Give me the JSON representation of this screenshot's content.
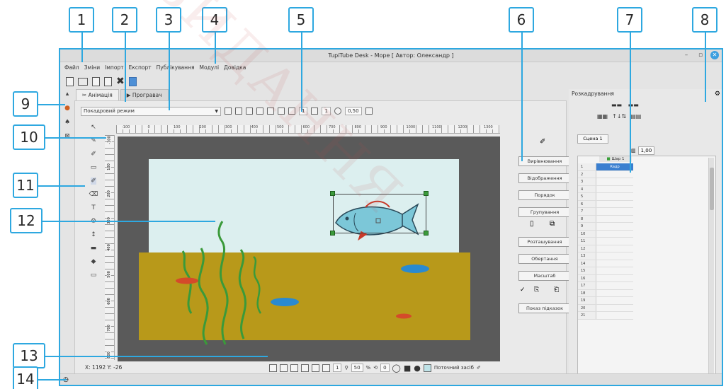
{
  "window": {
    "title": "TupiTube Desk - Море [ Автор: Олександр ]",
    "controls": {
      "minimize": "–",
      "maximize": "▫",
      "close": "✕"
    }
  },
  "menu": [
    "Файл",
    "Зміни",
    "Імпорт",
    "Експорт",
    "Публікування",
    "Модулі",
    "Довідка"
  ],
  "main_toolbar": [
    "new-file-icon",
    "open-folder-icon",
    "save-icon",
    "save-as-icon",
    "close-project-icon",
    "image-icon"
  ],
  "tabs": [
    {
      "label": "Анімація",
      "active": true
    },
    {
      "label": "Програвач",
      "active": false
    }
  ],
  "animation_toolbar": {
    "mode": "Покадровий режим",
    "frame_value": "1",
    "layer_value": "1",
    "opacity_value": "0,50"
  },
  "hruler_ticks": [
    "-100",
    "0",
    "100",
    "200",
    "300",
    "400",
    "500",
    "600",
    "700",
    "800",
    "900",
    "1000",
    "1100",
    "1200",
    "1300"
  ],
  "vruler_ticks": [
    "-100",
    "100",
    "200",
    "300",
    "400",
    "500",
    "600",
    "700",
    "800"
  ],
  "status": {
    "coords": "X: 1192 Y: -26"
  },
  "bottom_toolbar": {
    "frame": "1",
    "zoom": "50",
    "zoom_unit": "%",
    "rotation": "0",
    "current_tool_label": "Поточний засіб"
  },
  "properties_buttons": [
    "Вирівнювання",
    "Відображення",
    "Порядок",
    "Групування",
    "Розташування",
    "Обертання",
    "Масштаб",
    "Показ підказок"
  ],
  "right_panel": {
    "title": "Розкадрування",
    "scene_tab": "Сцена 1",
    "zoom_value": "1,00",
    "layer_name": "Шар 1",
    "first_frame_label": "Кадр",
    "frame_numbers": [
      "1",
      "2",
      "3",
      "4",
      "5",
      "6",
      "7",
      "8",
      "9",
      "10",
      "11",
      "12",
      "13",
      "14",
      "15",
      "16",
      "17",
      "18",
      "19",
      "20",
      "21"
    ]
  },
  "callouts": [
    "1",
    "2",
    "3",
    "4",
    "5",
    "6",
    "7",
    "8",
    "9",
    "10",
    "11",
    "12",
    "13",
    "14"
  ],
  "colors": {
    "accent": "#2ea8e0",
    "sky": "#dcefef",
    "sand": "#b8991a",
    "fish": "#7cc7d8",
    "seaweed": "#3a9a3a",
    "red_stone": "#d44a2a",
    "blue_stone": "#2a8ad0"
  }
}
